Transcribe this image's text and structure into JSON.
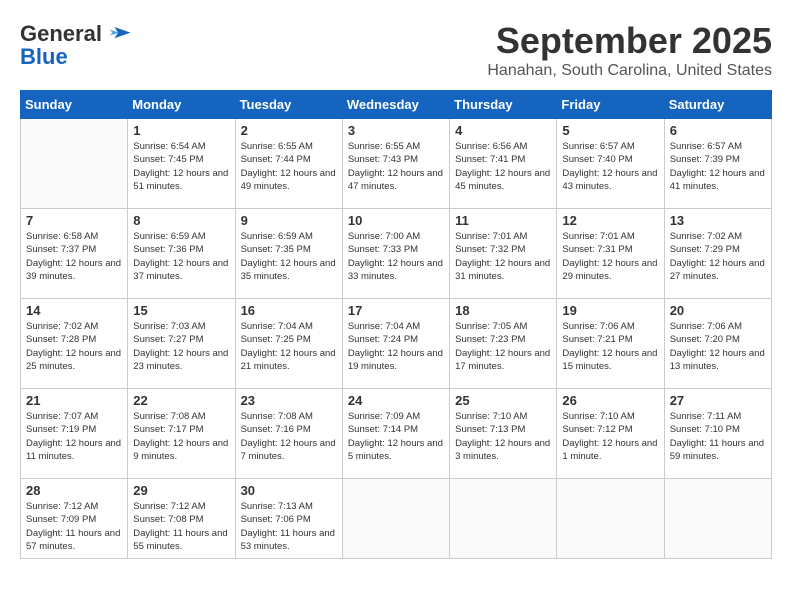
{
  "logo": {
    "general": "General",
    "blue": "Blue"
  },
  "title": "September 2025",
  "subtitle": "Hanahan, South Carolina, United States",
  "days_of_week": [
    "Sunday",
    "Monday",
    "Tuesday",
    "Wednesday",
    "Thursday",
    "Friday",
    "Saturday"
  ],
  "weeks": [
    [
      {
        "day": "",
        "sunrise": "",
        "sunset": "",
        "daylight": "",
        "empty": true
      },
      {
        "day": "1",
        "sunrise": "6:54 AM",
        "sunset": "7:45 PM",
        "daylight": "12 hours and 51 minutes."
      },
      {
        "day": "2",
        "sunrise": "6:55 AM",
        "sunset": "7:44 PM",
        "daylight": "12 hours and 49 minutes."
      },
      {
        "day": "3",
        "sunrise": "6:55 AM",
        "sunset": "7:43 PM",
        "daylight": "12 hours and 47 minutes."
      },
      {
        "day": "4",
        "sunrise": "6:56 AM",
        "sunset": "7:41 PM",
        "daylight": "12 hours and 45 minutes."
      },
      {
        "day": "5",
        "sunrise": "6:57 AM",
        "sunset": "7:40 PM",
        "daylight": "12 hours and 43 minutes."
      },
      {
        "day": "6",
        "sunrise": "6:57 AM",
        "sunset": "7:39 PM",
        "daylight": "12 hours and 41 minutes."
      }
    ],
    [
      {
        "day": "7",
        "sunrise": "6:58 AM",
        "sunset": "7:37 PM",
        "daylight": "12 hours and 39 minutes."
      },
      {
        "day": "8",
        "sunrise": "6:59 AM",
        "sunset": "7:36 PM",
        "daylight": "12 hours and 37 minutes."
      },
      {
        "day": "9",
        "sunrise": "6:59 AM",
        "sunset": "7:35 PM",
        "daylight": "12 hours and 35 minutes."
      },
      {
        "day": "10",
        "sunrise": "7:00 AM",
        "sunset": "7:33 PM",
        "daylight": "12 hours and 33 minutes."
      },
      {
        "day": "11",
        "sunrise": "7:01 AM",
        "sunset": "7:32 PM",
        "daylight": "12 hours and 31 minutes."
      },
      {
        "day": "12",
        "sunrise": "7:01 AM",
        "sunset": "7:31 PM",
        "daylight": "12 hours and 29 minutes."
      },
      {
        "day": "13",
        "sunrise": "7:02 AM",
        "sunset": "7:29 PM",
        "daylight": "12 hours and 27 minutes."
      }
    ],
    [
      {
        "day": "14",
        "sunrise": "7:02 AM",
        "sunset": "7:28 PM",
        "daylight": "12 hours and 25 minutes."
      },
      {
        "day": "15",
        "sunrise": "7:03 AM",
        "sunset": "7:27 PM",
        "daylight": "12 hours and 23 minutes."
      },
      {
        "day": "16",
        "sunrise": "7:04 AM",
        "sunset": "7:25 PM",
        "daylight": "12 hours and 21 minutes."
      },
      {
        "day": "17",
        "sunrise": "7:04 AM",
        "sunset": "7:24 PM",
        "daylight": "12 hours and 19 minutes."
      },
      {
        "day": "18",
        "sunrise": "7:05 AM",
        "sunset": "7:23 PM",
        "daylight": "12 hours and 17 minutes."
      },
      {
        "day": "19",
        "sunrise": "7:06 AM",
        "sunset": "7:21 PM",
        "daylight": "12 hours and 15 minutes."
      },
      {
        "day": "20",
        "sunrise": "7:06 AM",
        "sunset": "7:20 PM",
        "daylight": "12 hours and 13 minutes."
      }
    ],
    [
      {
        "day": "21",
        "sunrise": "7:07 AM",
        "sunset": "7:19 PM",
        "daylight": "12 hours and 11 minutes."
      },
      {
        "day": "22",
        "sunrise": "7:08 AM",
        "sunset": "7:17 PM",
        "daylight": "12 hours and 9 minutes."
      },
      {
        "day": "23",
        "sunrise": "7:08 AM",
        "sunset": "7:16 PM",
        "daylight": "12 hours and 7 minutes."
      },
      {
        "day": "24",
        "sunrise": "7:09 AM",
        "sunset": "7:14 PM",
        "daylight": "12 hours and 5 minutes."
      },
      {
        "day": "25",
        "sunrise": "7:10 AM",
        "sunset": "7:13 PM",
        "daylight": "12 hours and 3 minutes."
      },
      {
        "day": "26",
        "sunrise": "7:10 AM",
        "sunset": "7:12 PM",
        "daylight": "12 hours and 1 minute."
      },
      {
        "day": "27",
        "sunrise": "7:11 AM",
        "sunset": "7:10 PM",
        "daylight": "11 hours and 59 minutes."
      }
    ],
    [
      {
        "day": "28",
        "sunrise": "7:12 AM",
        "sunset": "7:09 PM",
        "daylight": "11 hours and 57 minutes."
      },
      {
        "day": "29",
        "sunrise": "7:12 AM",
        "sunset": "7:08 PM",
        "daylight": "11 hours and 55 minutes."
      },
      {
        "day": "30",
        "sunrise": "7:13 AM",
        "sunset": "7:06 PM",
        "daylight": "11 hours and 53 minutes."
      },
      {
        "day": "",
        "empty": true
      },
      {
        "day": "",
        "empty": true
      },
      {
        "day": "",
        "empty": true
      },
      {
        "day": "",
        "empty": true
      }
    ]
  ]
}
